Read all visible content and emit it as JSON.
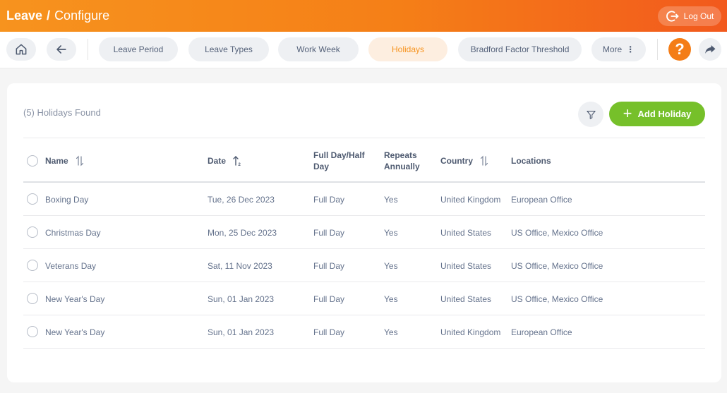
{
  "header": {
    "module": "Leave",
    "separator": "/",
    "page": "Configure",
    "logout_label": "Log Out"
  },
  "nav": {
    "tabs": [
      {
        "label": "Leave Period"
      },
      {
        "label": "Leave Types"
      },
      {
        "label": "Work Week"
      },
      {
        "label": "Holidays",
        "active": true
      },
      {
        "label": "Bradford Factor Threshold"
      },
      {
        "label": "More"
      }
    ],
    "help_label": "?"
  },
  "main": {
    "found_text": "(5) Holidays Found",
    "add_label": "Add Holiday",
    "columns": {
      "name": "Name",
      "date": "Date",
      "duration_line1": "Full Day/Half",
      "duration_line2": "Day",
      "repeats_line1": "Repeats",
      "repeats_line2": "Annually",
      "country": "Country",
      "locations": "Locations"
    },
    "rows": [
      {
        "name": "Boxing Day",
        "date": "Tue, 26 Dec 2023",
        "duration": "Full Day",
        "repeats": "Yes",
        "country": "United Kingdom",
        "locations": "European Office"
      },
      {
        "name": "Christmas Day",
        "date": "Mon, 25 Dec 2023",
        "duration": "Full Day",
        "repeats": "Yes",
        "country": "United States",
        "locations": "US Office, Mexico Office"
      },
      {
        "name": "Veterans Day",
        "date": "Sat, 11 Nov 2023",
        "duration": "Full Day",
        "repeats": "Yes",
        "country": "United States",
        "locations": "US Office, Mexico Office"
      },
      {
        "name": "New Year's Day",
        "date": "Sun, 01 Jan 2023",
        "duration": "Full Day",
        "repeats": "Yes",
        "country": "United States",
        "locations": "US Office, Mexico Office"
      },
      {
        "name": "New Year's Day",
        "date": "Sun, 01 Jan 2023",
        "duration": "Full Day",
        "repeats": "Yes",
        "country": "United Kingdom",
        "locations": "European Office"
      }
    ]
  },
  "colors": {
    "accent": "#f7931e",
    "header_end": "#f2591d",
    "add_button": "#76c02a",
    "help_button": "#f47d17"
  },
  "icons": {
    "home": "home-icon",
    "back": "arrow-left-icon",
    "more": "vertical-dots-icon",
    "help": "question-icon",
    "share": "share-arrow-icon",
    "filter": "funnel-icon",
    "add": "plus-icon",
    "logout": "logout-icon",
    "sort": "sort-arrows-icon"
  }
}
